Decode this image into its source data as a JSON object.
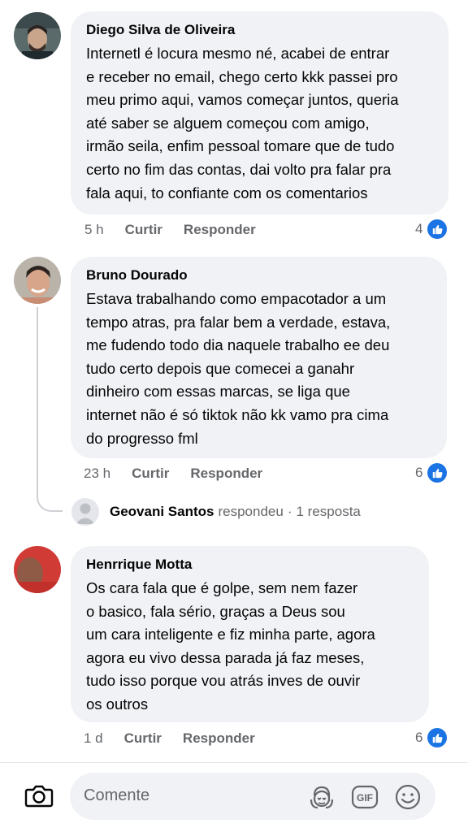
{
  "comments": [
    {
      "author": "Diego Silva de Oliveira",
      "text": "Internetl é locura mesmo né, acabei de entrar\ne receber no email, chego certo kkk passei pro\nmeu primo aqui, vamos começar juntos, queria\naté saber se alguem começou com amigo,\nirmão seila, enfim pessoal tomare que de tudo\ncerto no fim das contas, dai volto pra falar pra\nfala aqui, to confiante com os comentarios",
      "time": "5 h",
      "like_label": "Curtir",
      "reply_label": "Responder",
      "reaction_count": "4"
    },
    {
      "author": "Bruno Dourado",
      "text": "Estava trabalhando como empacotador a um\ntempo atras, pra falar bem a verdade, estava,\nme fudendo todo dia naquele trabalho ee deu\ntudo certo depois que comecei a ganahr\ndinheiro com essas marcas, se liga que\ninternet não é só tiktok não kk vamo pra cima\ndo progresso fml",
      "time": "23 h",
      "like_label": "Curtir",
      "reply_label": "Responder",
      "reaction_count": "6"
    },
    {
      "author": "Henrrique Motta",
      "text": "Os cara fala que é golpe, sem nem fazer\no basico, fala sério, graças a Deus sou\num cara inteligente e fiz minha parte, agora\nagora eu vivo dessa parada já faz meses,\ntudo isso porque vou atrás inves de ouvir\nos outros",
      "time": "1 d",
      "like_label": "Curtir",
      "reply_label": "Responder",
      "reaction_count": "6"
    }
  ],
  "reply_preview": {
    "name": "Geovani Santos",
    "action": "respondeu",
    "separator": "·",
    "count": "1 resposta"
  },
  "composer": {
    "placeholder": "Comente",
    "icons": [
      "camera-icon",
      "avatar-sticker-icon",
      "gif-icon",
      "emoji-icon"
    ],
    "gif_label": "GIF"
  },
  "colors": {
    "like_blue": "#1b74e4",
    "bubble_bg": "#f0f2f5",
    "meta_gray": "#65676b"
  }
}
